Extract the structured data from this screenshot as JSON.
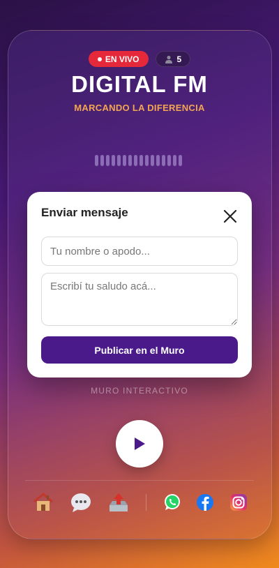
{
  "header": {
    "live_label": "EN VIVO",
    "listeners_count": "5",
    "station_name": "DIGITAL FM",
    "slogan": "MARCANDO LA DIFERENCIA"
  },
  "modal": {
    "title": "Enviar mensaje",
    "name_placeholder": "Tu nombre o apodo...",
    "message_placeholder": "Escribí tu saludo acá...",
    "publish_label": "Publicar en el Muro"
  },
  "wall_label": "MURO INTERACTIVO",
  "icons": {
    "home": "house-icon",
    "chat": "chat-bubble-icon",
    "share": "share-upload-icon",
    "whatsapp": "whatsapp-icon",
    "facebook": "facebook-icon",
    "instagram": "instagram-icon",
    "play": "play-icon",
    "close": "close-icon"
  },
  "colors": {
    "live_badge": "#e5283a",
    "slogan": "#f3a552",
    "publish_button": "#4a1a8a",
    "play_icon": "#4a1a8a"
  }
}
